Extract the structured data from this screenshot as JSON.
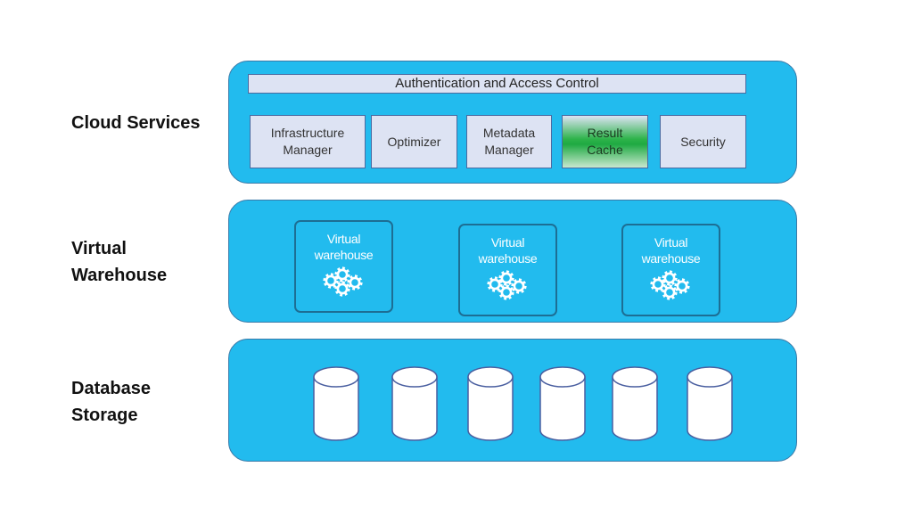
{
  "layers": {
    "cloud_services": {
      "label": "Cloud Services",
      "auth_bar": "Authentication and Access Control",
      "services": [
        {
          "label": "Infrastructure\nManager"
        },
        {
          "label": "Optimizer"
        },
        {
          "label": "Metadata\nManager"
        },
        {
          "label": "Result\nCache",
          "highlight_color": "#1faa42"
        },
        {
          "label": "Security"
        }
      ]
    },
    "virtual_warehouse": {
      "label_line1": "Virtual",
      "label_line2": "Warehouse",
      "warehouses": [
        {
          "label": "Virtual\nwarehouse",
          "icon": "gears-icon"
        },
        {
          "label": "Virtual\nwarehouse",
          "icon": "gears-icon"
        },
        {
          "label": "Virtual\nwarehouse",
          "icon": "gears-icon"
        }
      ]
    },
    "database_storage": {
      "label_line1": "Database",
      "label_line2": "Storage",
      "storage_count": 6,
      "storage_icon": "database-cylinder-icon"
    }
  },
  "colors": {
    "layer_fill": "#22bbee",
    "layer_border": "#3a7aa8",
    "service_fill": "#dde3f3",
    "result_cache": "#1faa42"
  }
}
